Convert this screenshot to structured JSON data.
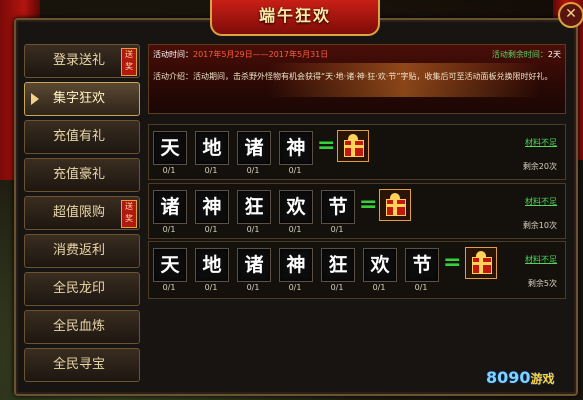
{
  "window": {
    "title": "端午狂欢"
  },
  "sidebar": {
    "items": [
      {
        "label": "登录送礼",
        "tag": "送奖"
      },
      {
        "label": "集字狂欢"
      },
      {
        "label": "充值有礼"
      },
      {
        "label": "充值豪礼"
      },
      {
        "label": "超值限购",
        "tag": "送奖"
      },
      {
        "label": "消费返利"
      },
      {
        "label": "全民龙印"
      },
      {
        "label": "全民血炼"
      },
      {
        "label": "全民寻宝"
      }
    ],
    "active_index": 1
  },
  "banner": {
    "time_label": "活动时间：",
    "time_value": "2017年5月29日——2017年5月31日",
    "remaining_label": "活动剩余时间：",
    "remaining_value": "2天",
    "intro": "活动介绍：活动期间，击杀野外怪物有机会获得“天·地·诸·神·狂·欢·节”字贴，收集后可至活动面板兑换限时好礼。"
  },
  "rows": [
    {
      "chars": [
        "天",
        "地",
        "诸",
        "神"
      ],
      "counts": [
        "0/1",
        "0/1",
        "0/1",
        "0/1"
      ],
      "status": "材料不足",
      "remaining": "剩余20次"
    },
    {
      "chars": [
        "诸",
        "神",
        "狂",
        "欢",
        "节"
      ],
      "counts": [
        "0/1",
        "0/1",
        "0/1",
        "0/1",
        "0/1"
      ],
      "status": "材料不足",
      "remaining": "剩余10次"
    },
    {
      "chars": [
        "天",
        "地",
        "诸",
        "神",
        "狂",
        "欢",
        "节"
      ],
      "counts": [
        "0/1",
        "0/1",
        "0/1",
        "0/1",
        "0/1",
        "0/1",
        "0/1"
      ],
      "status": "材料不足",
      "remaining": "剩余5次"
    }
  ],
  "equals_symbol": "=",
  "icons": {
    "reward": "gift-box-icon",
    "close": "close-icon",
    "selected": "arrow-right-icon"
  },
  "watermark": {
    "text": "8090",
    "suffix": "游戏"
  }
}
